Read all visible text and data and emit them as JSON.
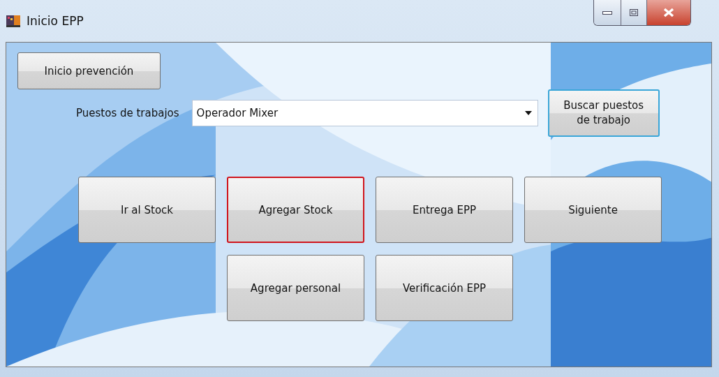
{
  "window": {
    "title": "Inicio EPP"
  },
  "top_button": {
    "label": "Inicio prevención"
  },
  "job_field": {
    "label": "Puestos de trabajos",
    "value": "Operador Mixer"
  },
  "search_button": {
    "label": "Buscar puestos de trabajo"
  },
  "action_rows": [
    [
      {
        "label": "Ir al Stock",
        "focused": false
      },
      {
        "label": "Agregar Stock",
        "focused": true
      },
      {
        "label": "Entrega EPP",
        "focused": false
      },
      {
        "label": "Siguiente",
        "focused": false
      }
    ],
    [
      {
        "label": "Agregar personal",
        "focused": false
      },
      {
        "label": "Verificación EPP",
        "focused": false
      }
    ]
  ]
}
